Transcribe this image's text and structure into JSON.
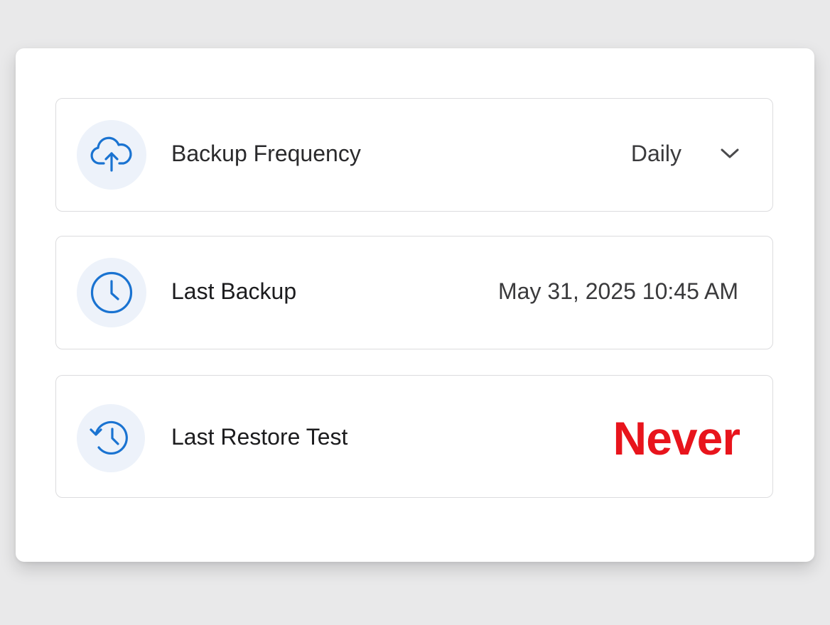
{
  "settings": {
    "backup_frequency": {
      "label": "Backup Frequency",
      "value": "Daily",
      "icon": "cloud-upload-icon"
    },
    "last_backup": {
      "label": "Last Backup",
      "value": "May 31, 2025 10:45 AM",
      "icon": "clock-icon"
    },
    "last_restore_test": {
      "label": "Last Restore Test",
      "value": "Never",
      "icon": "history-icon"
    }
  },
  "colors": {
    "accent": "#1a73d1",
    "icon_background": "#edf2fa",
    "warning": "#e8141c"
  }
}
